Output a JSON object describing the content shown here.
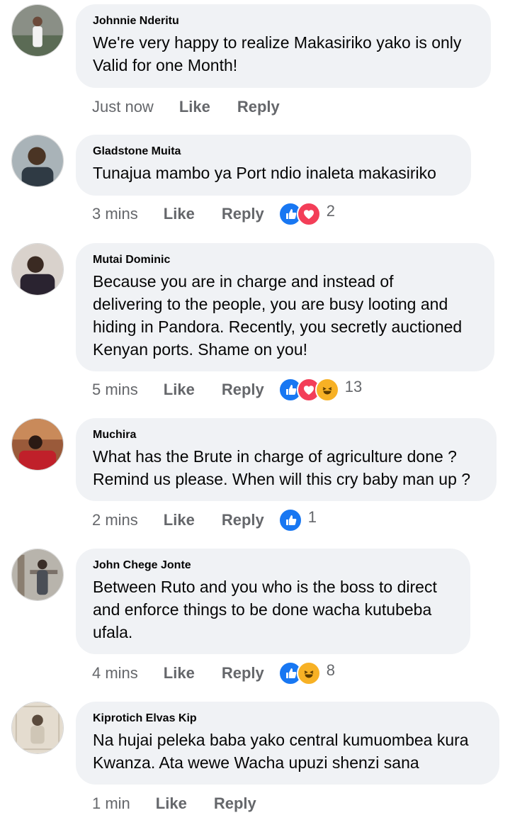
{
  "labels": {
    "like": "Like",
    "reply": "Reply"
  },
  "colors": {
    "bubble": "#f0f2f5",
    "meta_text": "#65676b",
    "like_blue": "#1877f2",
    "love_red": "#f33e58",
    "haha_yellow": "#f7b125"
  },
  "comments": [
    {
      "author": "Johnnie Nderitu",
      "text": "We're very happy to realize Makasiriko yako is only\nValid for one Month!",
      "time": "Just now",
      "reactions": [],
      "reaction_count": ""
    },
    {
      "author": "Gladstone Muita",
      "text": "Tunajua mambo ya Port ndio inaleta makasiriko",
      "time": "3 mins",
      "reactions": [
        "like-icon",
        "love-icon"
      ],
      "reaction_count": "2"
    },
    {
      "author": "Mutai Dominic",
      "text": "Because you are in charge and instead of\ndelivering to the people, you are busy looting and\nhiding in Pandora. Recently, you secretly auctioned\nKenyan ports. Shame on you!",
      "time": "5 mins",
      "reactions": [
        "like-icon",
        "love-icon",
        "haha-icon"
      ],
      "reaction_count": "13"
    },
    {
      "author": "Muchira",
      "text": "What has the Brute in charge of agriculture done ?\nRemind us please. When will this cry baby man up ?",
      "time": "2 mins",
      "reactions": [
        "like-icon"
      ],
      "reaction_count": "1"
    },
    {
      "author": "John Chege Jonte",
      "text": "Between Ruto and you who is the boss to direct\nand enforce things to be done wacha kutubeba\nufala.",
      "time": "4 mins",
      "reactions": [
        "like-icon",
        "haha-icon"
      ],
      "reaction_count": "8"
    },
    {
      "author": "Kiprotich Elvas Kip",
      "text": "Na hujai peleka baba yako central kumuombea kura\nKwanza. Ata wewe Wacha upuzi shenzi sana",
      "time": "1 min",
      "reactions": [],
      "reaction_count": ""
    }
  ]
}
